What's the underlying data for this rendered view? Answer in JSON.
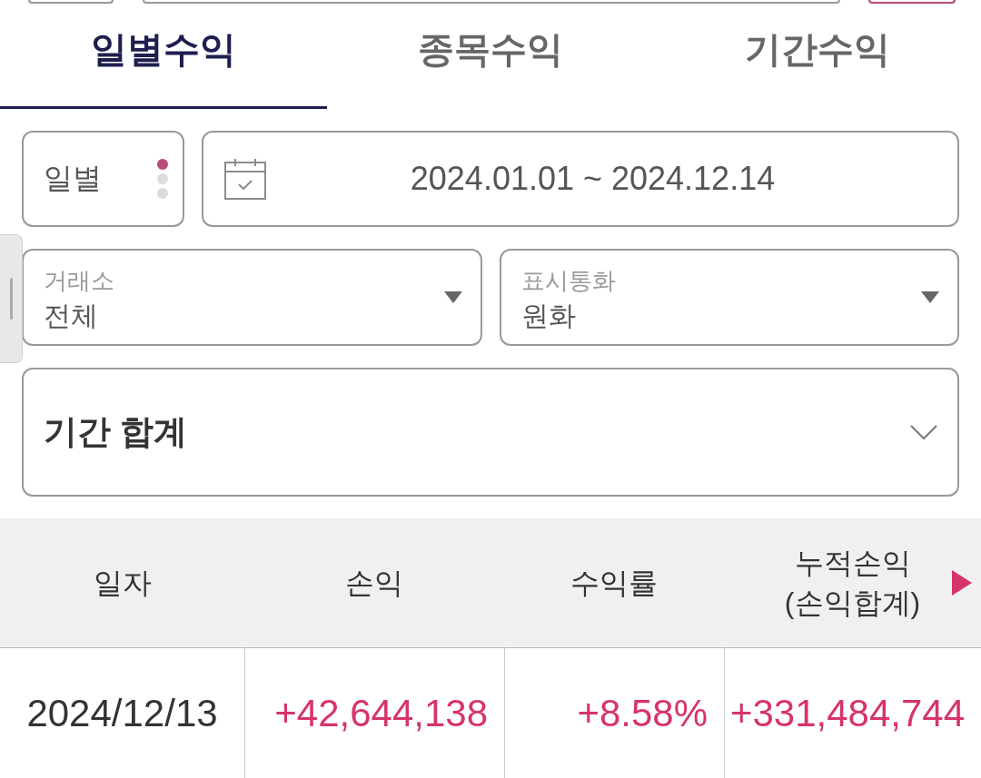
{
  "tabs": [
    {
      "label": "일별수익",
      "selected": true
    },
    {
      "label": "종목수익",
      "selected": false
    },
    {
      "label": "기간수익",
      "selected": false
    }
  ],
  "filters": {
    "period": {
      "value": "일별",
      "dots": [
        {
          "selected": true
        },
        {
          "selected": false
        },
        {
          "selected": false
        }
      ]
    },
    "date_range": {
      "value": "2024.01.01 ~ 2024.12.14"
    },
    "dropdowns": [
      {
        "label": "거래소",
        "value": "전체"
      },
      {
        "label": "표시통화",
        "value": "원화"
      }
    ]
  },
  "summary": {
    "title": "기간 합계",
    "expanded": false
  },
  "table": {
    "columns": [
      {
        "label": "일자"
      },
      {
        "label": "손익"
      },
      {
        "label": "수익률"
      },
      {
        "label": "누적손익 (손익합계)"
      }
    ],
    "rows": [
      {
        "gain": true,
        "cells": [
          "2024/12/13",
          "+42,644,138",
          "+8.58%",
          "+331,484,744"
        ]
      }
    ]
  }
}
